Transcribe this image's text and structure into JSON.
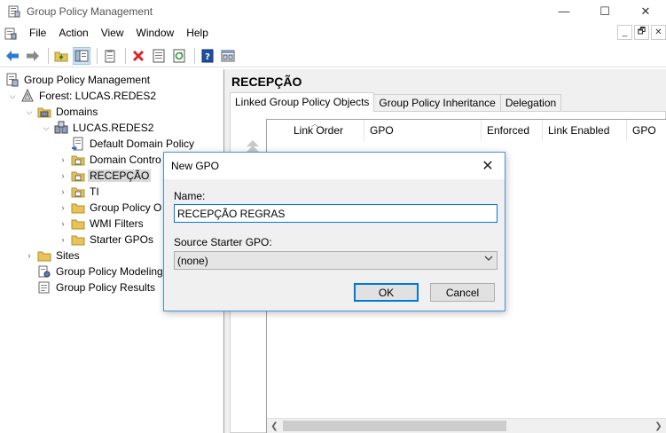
{
  "window": {
    "title": "Group Policy Management",
    "controls": {
      "minimize": "—",
      "maximize": "☐",
      "close": "✕"
    }
  },
  "menubar": {
    "items": [
      "File",
      "Action",
      "View",
      "Window",
      "Help"
    ],
    "mdi_controls": [
      "_",
      "🗗",
      "✕"
    ]
  },
  "toolbar": {
    "buttons": [
      "back-icon",
      "forward-icon",
      "up-folder-icon",
      "show-hide-tree-icon",
      "clipboard-icon",
      "delete-icon",
      "properties-icon",
      "refresh-icon",
      "help-icon",
      "mmc-view-icon"
    ]
  },
  "tree": {
    "items": [
      {
        "label": "Group Policy Management",
        "icon": "gpm-root-icon",
        "expander": ""
      },
      {
        "label": "Forest: LUCAS.REDES2",
        "icon": "forest-icon",
        "expander": "⌵"
      },
      {
        "label": "Domains",
        "icon": "domains-icon",
        "expander": "⌵"
      },
      {
        "label": "LUCAS.REDES2",
        "icon": "domain-icon",
        "expander": "⌵"
      },
      {
        "label": "Default Domain Policy",
        "icon": "gpo-link-icon",
        "expander": ""
      },
      {
        "label": "Domain Contro",
        "icon": "ou-icon",
        "expander": "›"
      },
      {
        "label": "RECEPÇÃO",
        "icon": "ou-icon",
        "expander": "›",
        "selected": true
      },
      {
        "label": "TI",
        "icon": "ou-icon",
        "expander": "›"
      },
      {
        "label": "Group Policy O",
        "icon": "folder-icon",
        "expander": "›"
      },
      {
        "label": "WMI Filters",
        "icon": "folder-icon",
        "expander": "›"
      },
      {
        "label": "Starter GPOs",
        "icon": "folder-icon",
        "expander": "›"
      },
      {
        "label": "Sites",
        "icon": "sites-icon",
        "expander": "›"
      },
      {
        "label": "Group Policy Modeling",
        "icon": "modeling-icon",
        "expander": ""
      },
      {
        "label": "Group Policy Results",
        "icon": "results-icon",
        "expander": ""
      }
    ]
  },
  "details": {
    "title": "RECEPÇÃO",
    "tabs": [
      "Linked Group Policy Objects",
      "Group Policy Inheritance",
      "Delegation"
    ],
    "active_tab": 0,
    "columns": [
      "Link Order",
      "GPO",
      "Enforced",
      "Link Enabled",
      "GPO"
    ]
  },
  "dialog": {
    "title": "New GPO",
    "name_label": "Name:",
    "name_value": "RECEPÇÃO REGRAS",
    "starter_label": "Source Starter GPO:",
    "starter_value": "(none)",
    "ok_label": "OK",
    "cancel_label": "Cancel"
  },
  "colors": {
    "accent": "#0078d7",
    "selection": "#d9d9d9",
    "chrome": "#f0f0f0"
  }
}
